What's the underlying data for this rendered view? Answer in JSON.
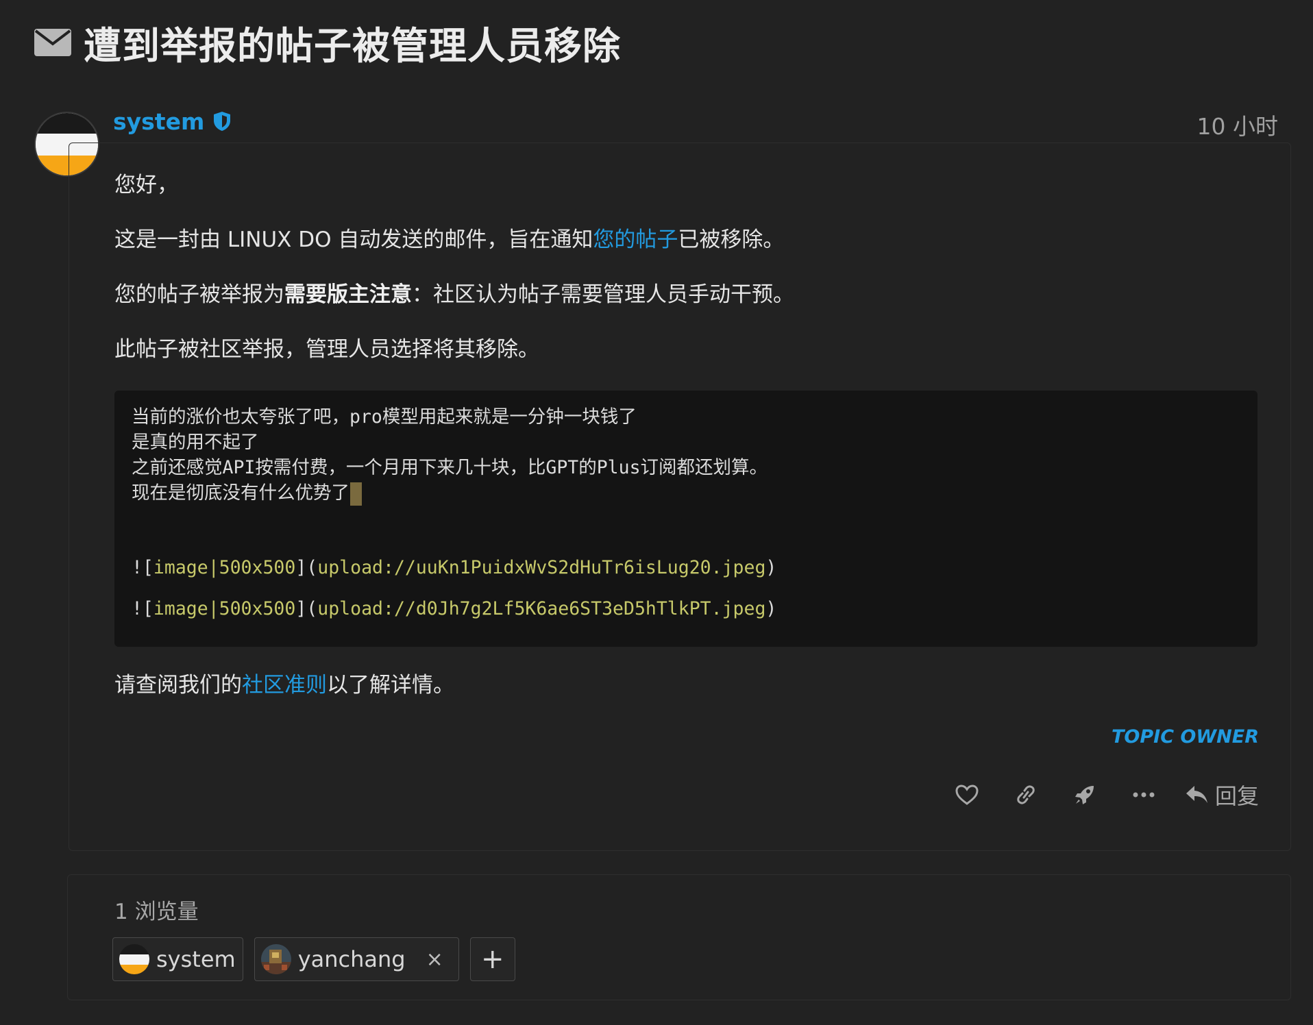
{
  "topic": {
    "title": "遭到举报的帖子被管理人员移除",
    "icon": "envelope-icon"
  },
  "post": {
    "username": "system",
    "time": "10 小时",
    "greeting": "您好，",
    "line1_before": "这是一封由 LINUX DO 自动发送的邮件，旨在通知",
    "line1_link": "您的帖子",
    "line1_after": "已被移除。",
    "line2_before": "您的帖子被举报为",
    "line2_strong": "需要版主注意",
    "line2_after": "：社区认为帖子需要管理人员手动干预。",
    "line3": "此帖子被社区举报，管理人员选择将其移除。",
    "code": {
      "line1": "当前的涨价也太夸张了吧，pro模型用起来就是一分钟一块钱了",
      "line2": "是真的用不起了",
      "line3": "之前还感觉API按需付费，一个月用下来几十块，比GPT的Plus订阅都还划算。",
      "line4": "现在是彻底没有什么优势了",
      "img1_prefix": "![",
      "img1_alt": "image|500x500",
      "img1_mid": "](",
      "img1_url": "upload://uuKn1PuidxWvS2dHuTr6isLug20.jpeg",
      "img1_suffix": ")",
      "img2_prefix": "![",
      "img2_alt": "image|500x500",
      "img2_mid": "](",
      "img2_url": "upload://d0Jh7g2Lf5K6ae6ST3eD5hTlkPT.jpeg",
      "img2_suffix": ")"
    },
    "footer_before": "请查阅我们的",
    "footer_link": "社区准则",
    "footer_after": "以了解详情。",
    "badge": "TOPIC OWNER",
    "reply_label": "回复"
  },
  "meta": {
    "views": "1 浏览量",
    "participants": [
      {
        "name": "system"
      },
      {
        "name": "yanchang",
        "remove": "×"
      }
    ],
    "add": "+"
  },
  "colors": {
    "background": "#222222",
    "accent": "#229be0",
    "code_background": "#141414",
    "markdown_highlight": "#c7c96a",
    "avatar_orange": "#f6a616"
  }
}
